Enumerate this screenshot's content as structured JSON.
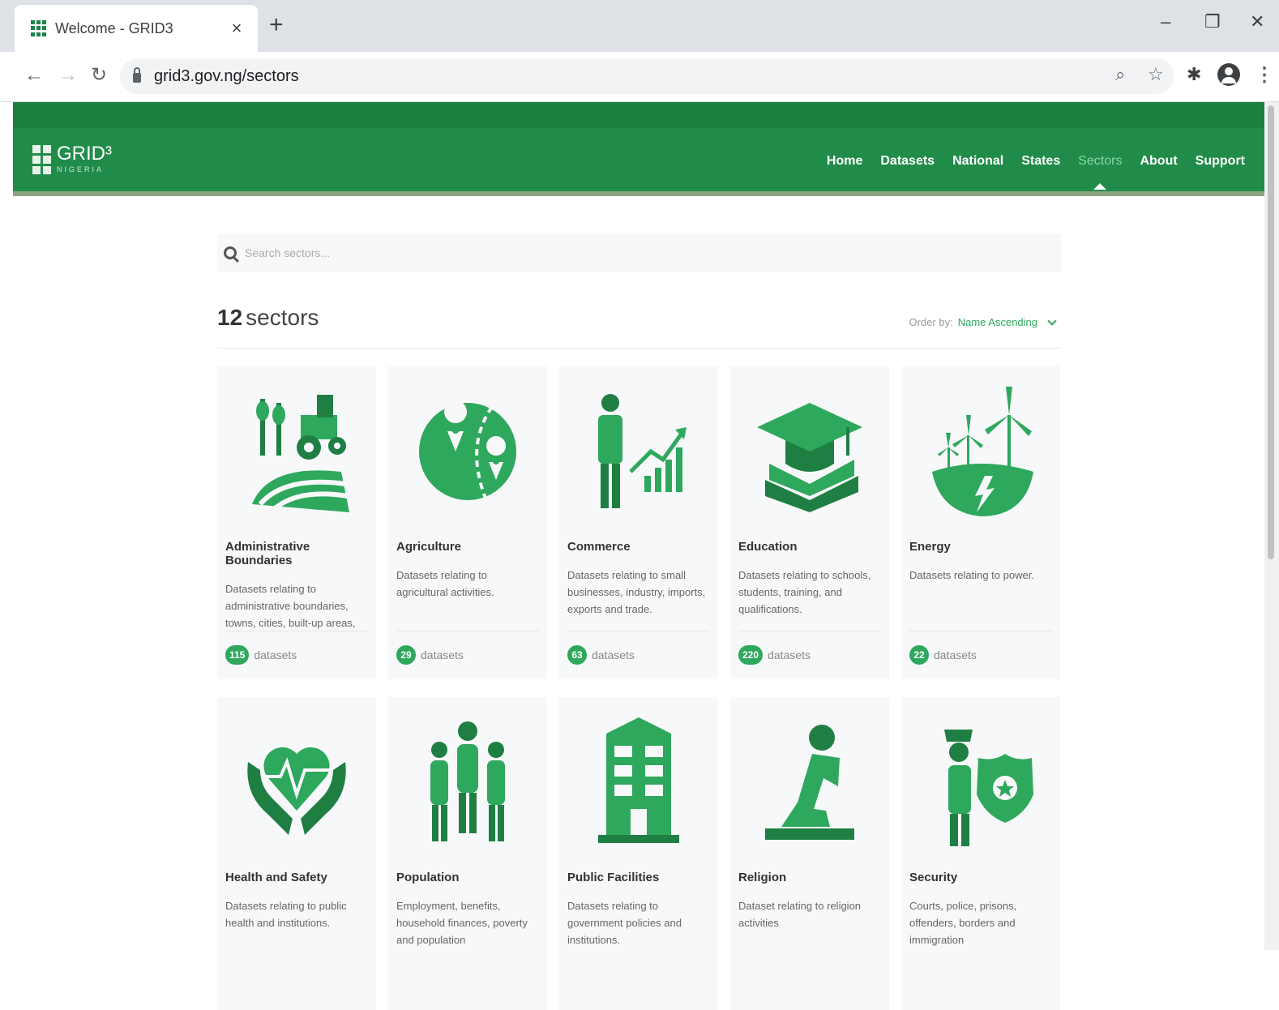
{
  "browser": {
    "tab_title": "Welcome - GRID3",
    "tab_close": "×",
    "new_tab": "+",
    "url": "grid3.gov.ng/sectors",
    "window_controls": [
      "–",
      "❐",
      "✕"
    ]
  },
  "site": {
    "logo_text": "GRID³",
    "logo_sub": "NIGERIA",
    "nav": [
      "Home",
      "Datasets",
      "National",
      "States",
      "Sectors",
      "About",
      "Support"
    ],
    "active_nav": "Sectors",
    "brand_color": "#218c4a",
    "accent_color": "#2ea85c"
  },
  "search": {
    "placeholder": "Search sectors..."
  },
  "summary": {
    "count": "12",
    "label": "sectors",
    "order_by_label": "Order by:",
    "order_by_value": "Name Ascending"
  },
  "datasets_label": "datasets",
  "sectors": [
    {
      "title": "Administrative Boundaries",
      "desc": "Datasets relating to administrative boundaries, towns, cities, built-up areas, settlements, housing ...",
      "count": "115",
      "icon": "farm-tractor-icon"
    },
    {
      "title": "Agriculture",
      "desc": "Datasets relating to agricultural activities.",
      "count": "29",
      "icon": "map-pin-globe-icon"
    },
    {
      "title": "Commerce",
      "desc": "Datasets relating to small businesses, industry, imports, exports and trade.",
      "count": "63",
      "icon": "businessman-chart-icon"
    },
    {
      "title": "Education",
      "desc": "Datasets relating to schools, students, training, and qualifications.",
      "count": "220",
      "icon": "graduation-cap-book-icon"
    },
    {
      "title": "Energy",
      "desc": "Datasets relating to power.",
      "count": "22",
      "icon": "wind-turbine-icon"
    },
    {
      "title": "Health and Safety",
      "desc": "Datasets relating to public health and institutions.",
      "count": "",
      "icon": "heart-hands-icon"
    },
    {
      "title": "Population",
      "desc": "Employment, benefits, household finances, poverty and population",
      "count": "",
      "icon": "people-group-icon"
    },
    {
      "title": "Public Facilities",
      "desc": "Datasets relating to government policies and institutions.",
      "count": "",
      "icon": "building-icon"
    },
    {
      "title": "Religion",
      "desc": "Dataset relating to religion activities",
      "count": "",
      "icon": "praying-person-icon"
    },
    {
      "title": "Security",
      "desc": "Courts, police, prisons, offenders, borders and immigration",
      "count": "",
      "icon": "police-badge-icon"
    }
  ]
}
